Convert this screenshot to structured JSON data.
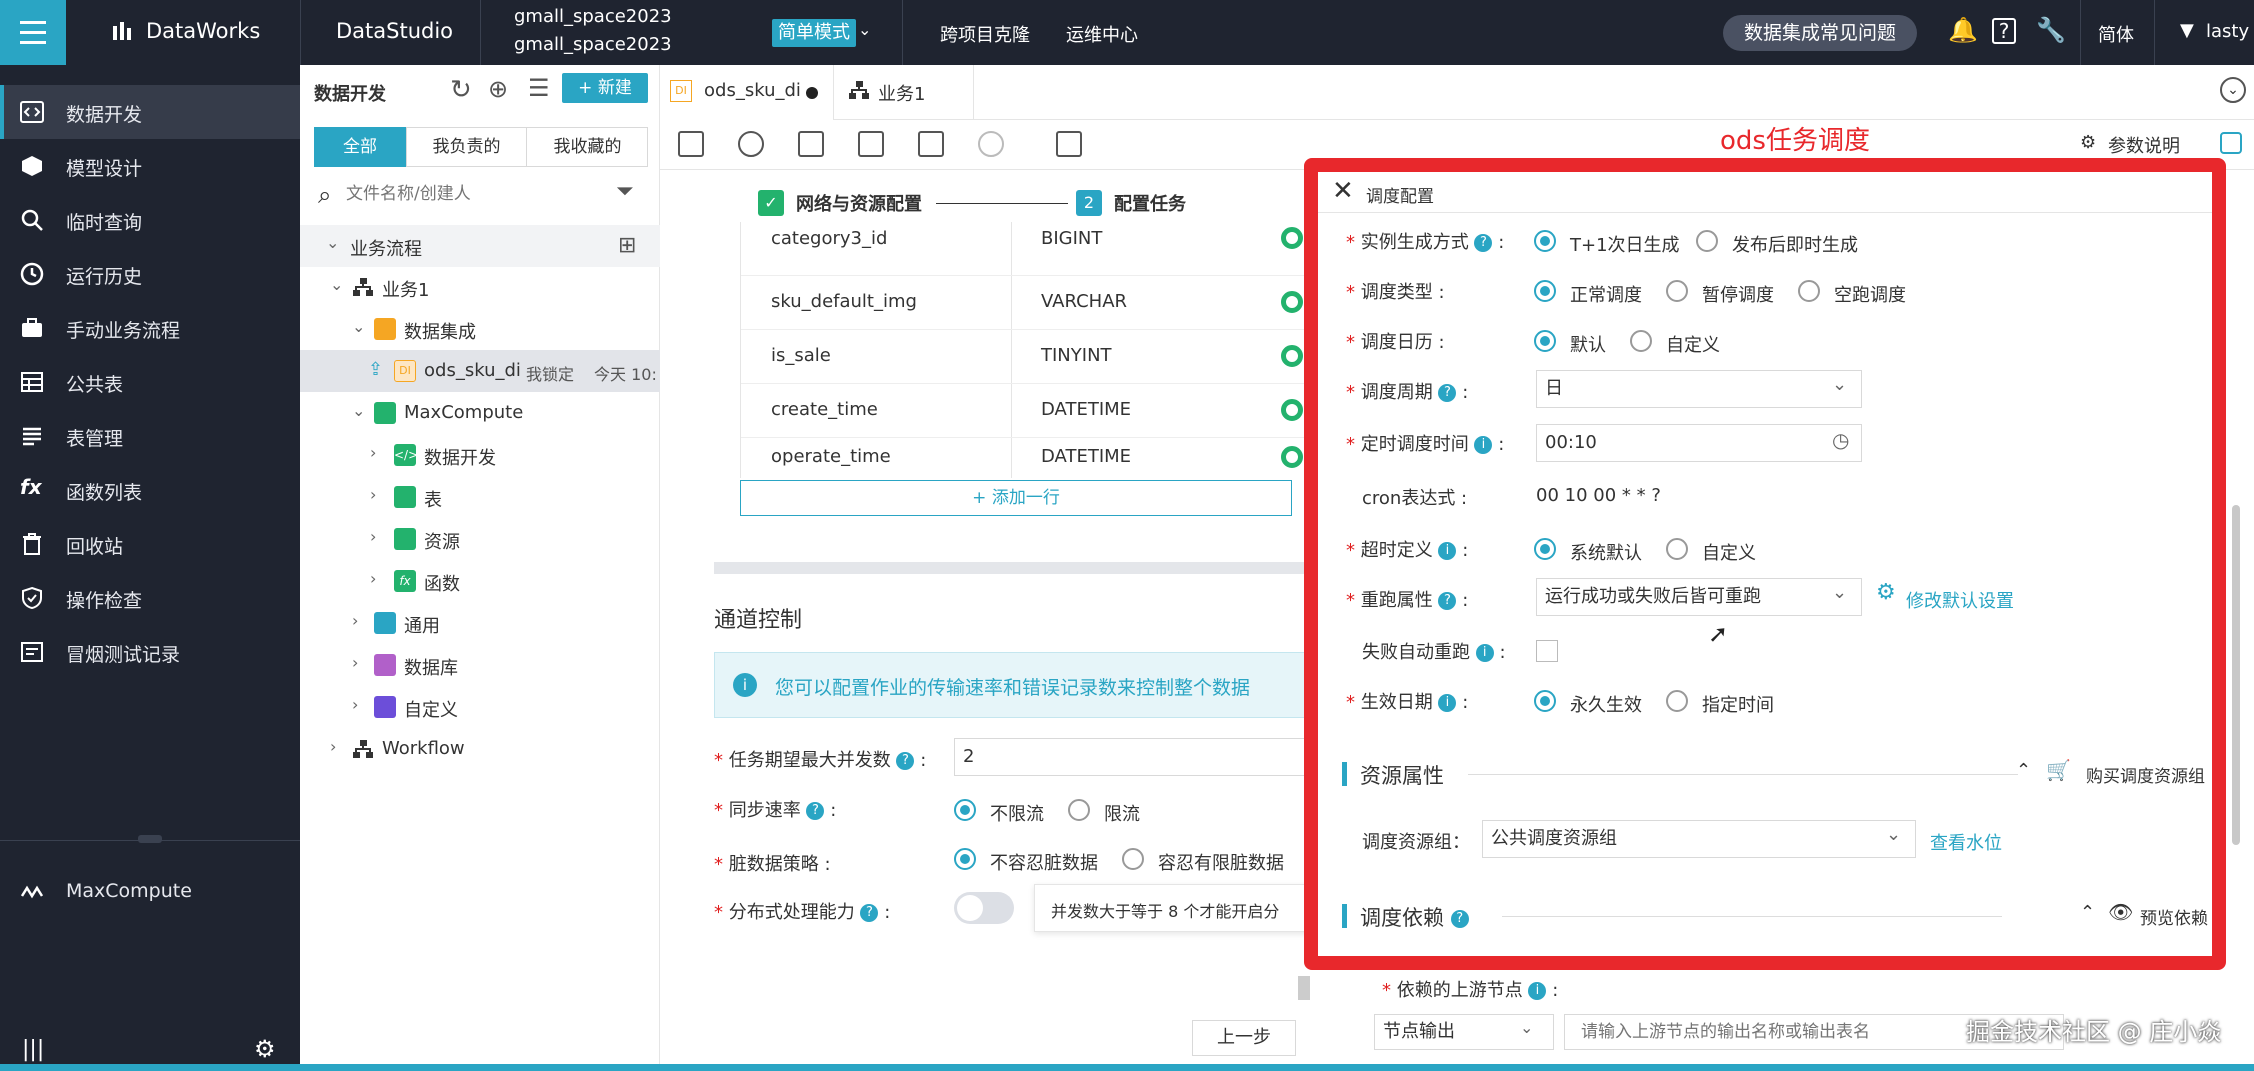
{
  "topbar": {
    "brand": "DataWorks",
    "studio": "DataStudio",
    "workspace_line1": "gmall_space2023",
    "workspace_line2": "gmall_space2023",
    "mode": "简单模式",
    "nav1": "跨项目克隆",
    "nav2": "运维中心",
    "faq": "数据集成常见问题",
    "lang": "简体",
    "user": "lasty"
  },
  "sidebar": {
    "items": [
      {
        "label": "数据开发",
        "icon": "code-icon"
      },
      {
        "label": "模型设计",
        "icon": "cube-icon"
      },
      {
        "label": "临时查询",
        "icon": "search-icon"
      },
      {
        "label": "运行历史",
        "icon": "clock-icon"
      },
      {
        "label": "手动业务流程",
        "icon": "briefcase-icon"
      },
      {
        "label": "公共表",
        "icon": "table-icon"
      },
      {
        "label": "表管理",
        "icon": "list-icon"
      },
      {
        "label": "函数列表",
        "icon": "fx-icon"
      },
      {
        "label": "回收站",
        "icon": "trash-icon"
      },
      {
        "label": "操作检查",
        "icon": "shield-icon"
      },
      {
        "label": "冒烟测试记录",
        "icon": "record-icon"
      }
    ],
    "bottom_item": "MaxCompute"
  },
  "tree": {
    "title": "数据开发",
    "new_button": "+ 新建",
    "tabs": [
      "全部",
      "我负责的",
      "我收藏的"
    ],
    "search_placeholder": "文件名称/创建人",
    "section": "业务流程",
    "rows": [
      {
        "label": "业务1"
      },
      {
        "label": "数据集成"
      },
      {
        "label": "ods_sku_di",
        "badge": "我锁定",
        "time": "今天 10:"
      },
      {
        "label": "MaxCompute"
      },
      {
        "label": "数据开发"
      },
      {
        "label": "表"
      },
      {
        "label": "资源"
      },
      {
        "label": "函数"
      },
      {
        "label": "通用"
      },
      {
        "label": "数据库"
      },
      {
        "label": "自定义"
      },
      {
        "label": "Workflow"
      }
    ]
  },
  "tabs": {
    "active": "ods_sku_di",
    "second": "业务1"
  },
  "toolbar": {
    "param_doc": "参数说明"
  },
  "steps": {
    "step1": "网络与资源配置",
    "step2_num": "2",
    "step2": "配置任务"
  },
  "columns": [
    {
      "name": "category3_id",
      "type": "BIGINT"
    },
    {
      "name": "sku_default_img",
      "type": "VARCHAR"
    },
    {
      "name": "is_sale",
      "type": "TINYINT"
    },
    {
      "name": "create_time",
      "type": "DATETIME"
    },
    {
      "name": "operate_time",
      "type": "DATETIME"
    }
  ],
  "add_row": "+ 添加一行",
  "channel": {
    "title": "通道控制",
    "info": "您可以配置作业的传输速率和错误记录数来控制整个数据",
    "concurrency_label": "任务期望最大并发数",
    "concurrency_value": "2",
    "speed_label": "同步速率",
    "speed_opt1": "不限流",
    "speed_opt2": "限流",
    "dirty_label": "脏数据策略",
    "dirty_opt1": "不容忍脏数据",
    "dirty_opt2": "容忍有限脏数据",
    "dist_label": "分布式处理能力",
    "dist_hint": "并发数大于等于 8 个才能开启分",
    "prev_button": "上一步"
  },
  "annotation": "ods任务调度",
  "modal": {
    "title": "调度配置",
    "instance_label": "实例生成方式",
    "instance_opt1": "T+1次日生成",
    "instance_opt2": "发布后即时生成",
    "type_label": "调度类型",
    "type_opt1": "正常调度",
    "type_opt2": "暂停调度",
    "type_opt3": "空跑调度",
    "calendar_label": "调度日历",
    "calendar_opt1": "默认",
    "calendar_opt2": "自定义",
    "period_label": "调度周期",
    "period_value": "日",
    "time_label": "定时调度时间",
    "time_value": "00:10",
    "cron_label": "cron表达式",
    "cron_value": "00 10 00 * * ?",
    "timeout_label": "超时定义",
    "timeout_opt1": "系统默认",
    "timeout_opt2": "自定义",
    "rerun_label": "重跑属性",
    "rerun_value": "运行成功或失败后皆可重跑",
    "rerun_link": "修改默认设置",
    "autorerun_label": "失败自动重跑",
    "effective_label": "生效日期",
    "effective_opt1": "永久生效",
    "effective_opt2": "指定时间",
    "resource_section": "资源属性",
    "buy_resource": "购买调度资源组",
    "resource_label": "调度资源组：",
    "resource_value": "公共调度资源组",
    "water_link": "查看水位",
    "dep_section": "调度依赖",
    "preview_dep": "预览依赖"
  },
  "below_modal": {
    "upstream_label": "依赖的上游节点",
    "node_output": "节点输出",
    "upstream_placeholder": "请输入上游节点的输出名称或输出表名"
  },
  "watermark": "掘金技术社区 @ 庄小焱",
  "colors": {
    "accent": "#2aa5c4",
    "dark": "#1f2430",
    "red_frame": "#e8282c",
    "green_ok": "#23b26d"
  }
}
